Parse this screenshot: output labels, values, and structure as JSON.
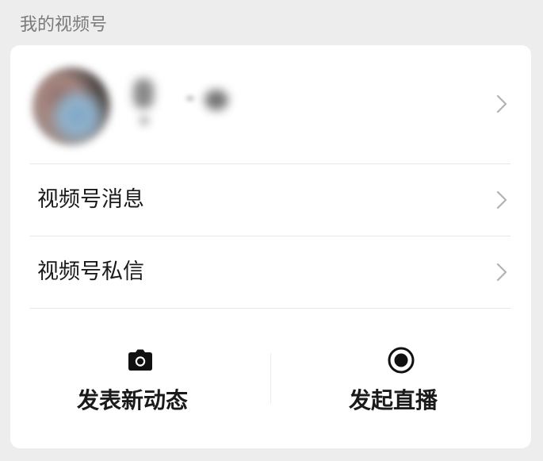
{
  "section": {
    "title": "我的视频号"
  },
  "profile": {
    "avatar_icon": "blurred-avatar",
    "chevron_icon": "chevron-right-icon"
  },
  "menu": {
    "items": [
      {
        "label": "视频号消息",
        "icon": "chevron-right-icon"
      },
      {
        "label": "视频号私信",
        "icon": "chevron-right-icon"
      }
    ]
  },
  "actions": {
    "post": {
      "label": "发表新动态",
      "icon": "camera-icon"
    },
    "live": {
      "label": "发起直播",
      "icon": "record-icon"
    }
  },
  "colors": {
    "background": "#ededed",
    "card": "#ffffff",
    "text": "#1a1a1a",
    "secondary_text": "#7a7a7a",
    "chevron": "#b2b2b2",
    "divider": "#e6e6e6"
  }
}
